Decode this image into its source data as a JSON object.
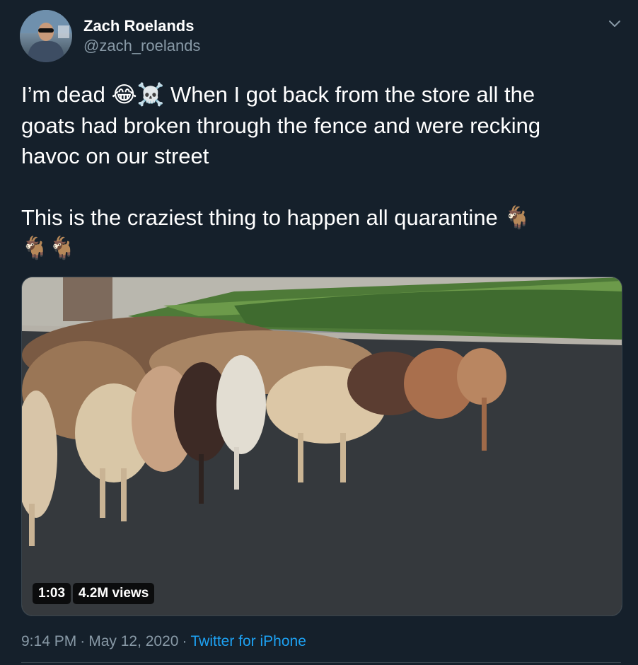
{
  "author": {
    "display_name": "Zach Roelands",
    "handle": "@zach_roelands"
  },
  "tweet": {
    "line1": "I’m dead 😂☠️ When I got back from the store all the",
    "line2": "goats had broken through the fence and were recking",
    "line3": "havoc on our street",
    "line4": "This is the craziest thing to happen all quarantine 🐐",
    "line5": "🐐🐐"
  },
  "media": {
    "duration": "1:03",
    "views": "4.2M views"
  },
  "meta": {
    "time": "9:14 PM",
    "separator": "·",
    "date": "May 12, 2020",
    "source": "Twitter for iPhone"
  },
  "icons": {
    "caret": "chevron-down-icon"
  },
  "colors": {
    "background": "#15202b",
    "secondary_text": "#8899a6",
    "link": "#1da1f2",
    "border": "#38444d"
  }
}
